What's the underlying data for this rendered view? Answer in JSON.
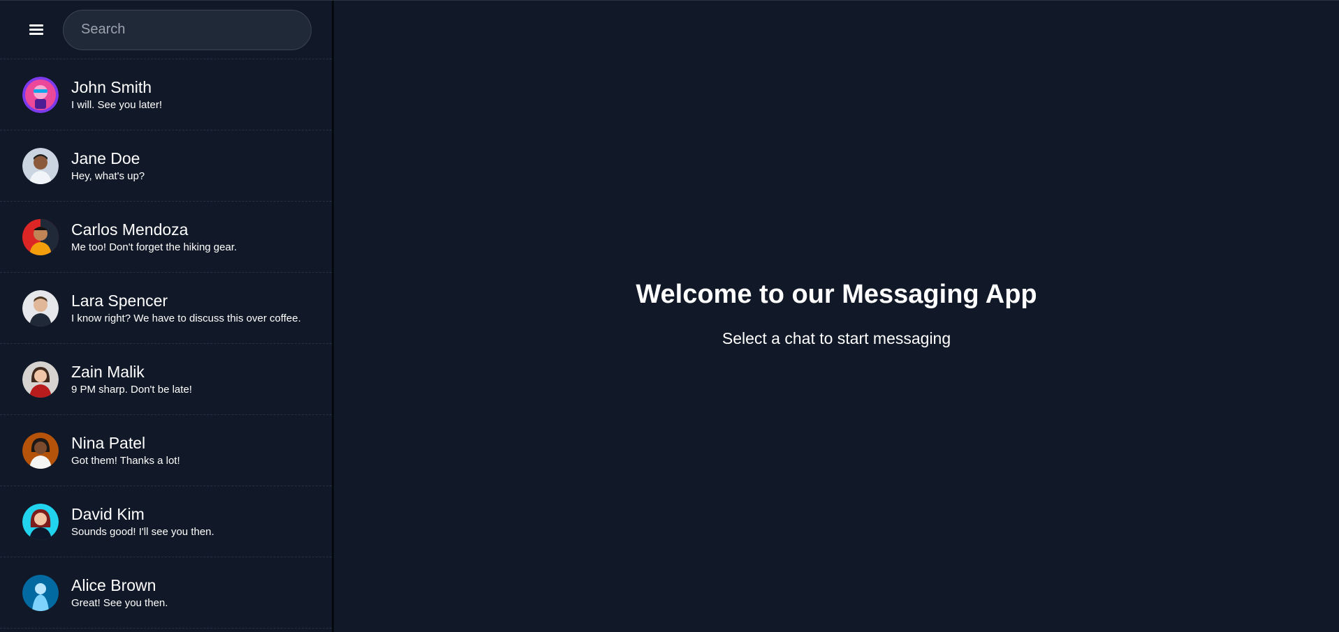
{
  "search": {
    "placeholder": "Search",
    "icon": "hamburger-menu-icon"
  },
  "contacts": [
    {
      "name": "John Smith",
      "last_message": "I will. See you later!"
    },
    {
      "name": "Jane Doe",
      "last_message": "Hey, what's up?"
    },
    {
      "name": "Carlos Mendoza",
      "last_message": "Me too! Don't forget the hiking gear."
    },
    {
      "name": "Lara Spencer",
      "last_message": "I know right? We have to discuss this over coffee."
    },
    {
      "name": "Zain Malik",
      "last_message": "9 PM sharp. Don't be late!"
    },
    {
      "name": "Nina Patel",
      "last_message": "Got them! Thanks a lot!"
    },
    {
      "name": "David Kim",
      "last_message": "Sounds good! I'll see you then."
    },
    {
      "name": "Alice Brown",
      "last_message": "Great! See you then."
    }
  ],
  "main": {
    "title": "Welcome to our Messaging App",
    "subtitle": "Select a chat to start messaging"
  },
  "colors": {
    "background": "#111827",
    "search_background": "#1f2937",
    "divider": "#243243",
    "text": "#ffffff"
  }
}
